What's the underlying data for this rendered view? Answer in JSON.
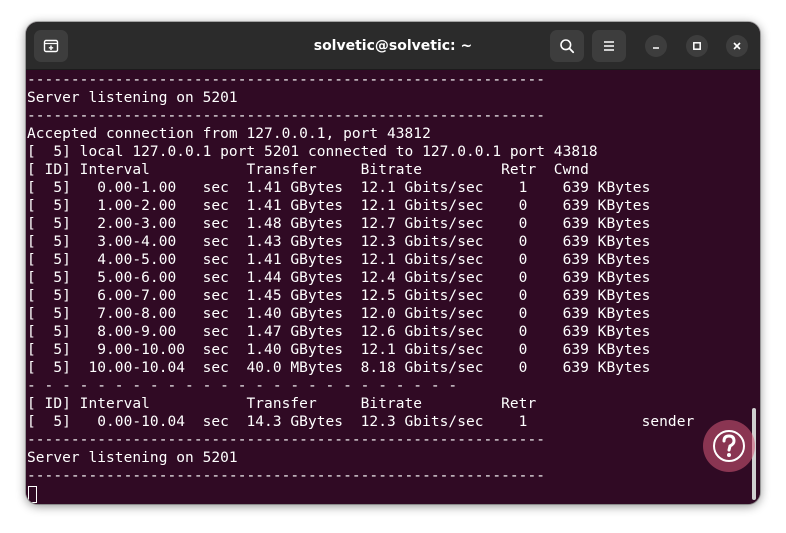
{
  "window": {
    "title": "solvetic@solvetic: ~"
  },
  "titlebar": {
    "icons": [
      "new-tab-icon",
      "search-icon",
      "hamburger-menu-icon",
      "minimize-icon",
      "maximize-icon",
      "close-icon"
    ]
  },
  "colors": {
    "titlebar_bg": "#2b2b2b",
    "button_bg": "#3d3d3d",
    "terminal_bg": "#300a24",
    "terminal_fg": "#ffffff"
  },
  "terminal": {
    "lines": [
      "-----------------------------------------------------------",
      "Server listening on 5201",
      "-----------------------------------------------------------",
      "Accepted connection from 127.0.0.1, port 43812",
      "[  5] local 127.0.0.1 port 5201 connected to 127.0.0.1 port 43818",
      "[ ID] Interval           Transfer     Bitrate         Retr  Cwnd",
      "[  5]   0.00-1.00   sec  1.41 GBytes  12.1 Gbits/sec    1    639 KBytes",
      "[  5]   1.00-2.00   sec  1.41 GBytes  12.1 Gbits/sec    0    639 KBytes",
      "[  5]   2.00-3.00   sec  1.48 GBytes  12.7 Gbits/sec    0    639 KBytes",
      "[  5]   3.00-4.00   sec  1.43 GBytes  12.3 Gbits/sec    0    639 KBytes",
      "[  5]   4.00-5.00   sec  1.41 GBytes  12.1 Gbits/sec    0    639 KBytes",
      "[  5]   5.00-6.00   sec  1.44 GBytes  12.4 Gbits/sec    0    639 KBytes",
      "[  5]   6.00-7.00   sec  1.45 GBytes  12.5 Gbits/sec    0    639 KBytes",
      "[  5]   7.00-8.00   sec  1.40 GBytes  12.0 Gbits/sec    0    639 KBytes",
      "[  5]   8.00-9.00   sec  1.47 GBytes  12.6 Gbits/sec    0    639 KBytes",
      "[  5]   9.00-10.00  sec  1.40 GBytes  12.1 Gbits/sec    0    639 KBytes",
      "[  5]  10.00-10.04  sec  40.0 MBytes  8.18 Gbits/sec    0    639 KBytes",
      "- - - - - - - - - - - - - - - - - - - - - - - - -",
      "[ ID] Interval           Transfer     Bitrate         Retr",
      "[  5]   0.00-10.04  sec  14.3 GBytes  12.3 Gbits/sec    1             sender",
      "-----------------------------------------------------------",
      "Server listening on 5201",
      "-----------------------------------------------------------"
    ]
  }
}
